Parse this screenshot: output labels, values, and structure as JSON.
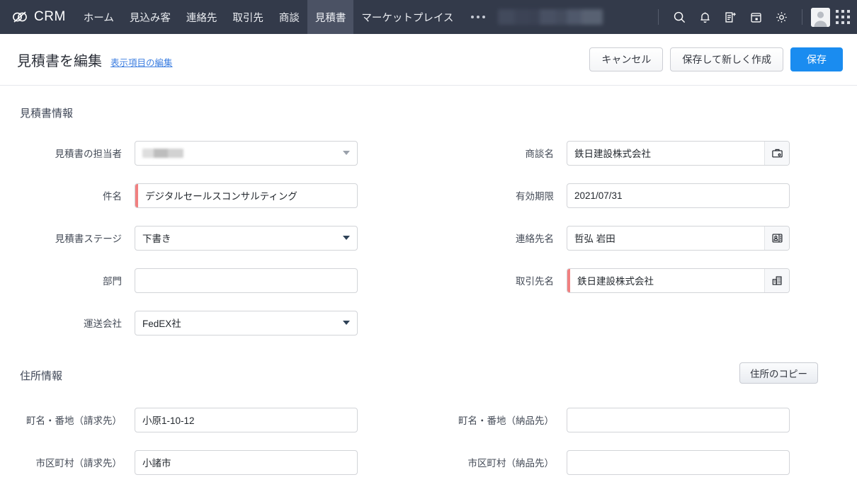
{
  "app": {
    "brand": "CRM",
    "nav_items": [
      {
        "label": "ホーム",
        "active": false
      },
      {
        "label": "見込み客",
        "active": false
      },
      {
        "label": "連絡先",
        "active": false
      },
      {
        "label": "取引先",
        "active": false
      },
      {
        "label": "商談",
        "active": false
      },
      {
        "label": "見積書",
        "active": true
      },
      {
        "label": "マーケットプレイス",
        "active": false
      }
    ],
    "more_label": "...",
    "icons": [
      "search-icon",
      "bell-icon",
      "add-note-icon",
      "calendar-icon",
      "gear-icon",
      "avatar",
      "apps-grid-icon"
    ]
  },
  "header": {
    "title": "見積書を編集",
    "edit_fields_link": "表示項目の編集",
    "cancel_label": "キャンセル",
    "save_new_label": "保存して新しく作成",
    "save_label": "保存",
    "primary_color": "#1a8cf0"
  },
  "sections": {
    "quote_info": {
      "title": "見積書情報",
      "left_fields": [
        {
          "label": "見積書の担当者",
          "value": "",
          "type": "select",
          "required": false,
          "redacted": true,
          "caret": "muted"
        },
        {
          "label": "件名",
          "value": "デジタルセールスコンサルティング",
          "type": "text",
          "required": true
        },
        {
          "label": "見積書ステージ",
          "value": "下書き",
          "type": "select",
          "required": false,
          "caret": "dark"
        },
        {
          "label": "部門",
          "value": "",
          "type": "text",
          "required": false
        },
        {
          "label": "運送会社",
          "value": "FedEX社",
          "type": "select",
          "required": false,
          "caret": "dark"
        }
      ],
      "right_fields": [
        {
          "label": "商談名",
          "value": "鉄日建設株式会社",
          "type": "lookup",
          "required": false,
          "icon": "deal-lookup-icon"
        },
        {
          "label": "有効期限",
          "value": "2021/07/31",
          "type": "text",
          "required": false
        },
        {
          "label": "連絡先名",
          "value": "哲弘 岩田",
          "type": "lookup",
          "required": false,
          "icon": "contact-lookup-icon"
        },
        {
          "label": "取引先名",
          "value": "鉄日建設株式会社",
          "type": "lookup",
          "required": true,
          "icon": "account-lookup-icon"
        }
      ]
    },
    "address_info": {
      "title": "住所情報",
      "copy_address_label": "住所のコピー",
      "left_fields": [
        {
          "label": "町名・番地（請求先）",
          "value": "小原1-10-12",
          "type": "text",
          "required": false
        },
        {
          "label": "市区町村（請求先）",
          "value": "小諸市",
          "type": "text",
          "required": false
        }
      ],
      "right_fields": [
        {
          "label": "町名・番地（納品先）",
          "value": "",
          "type": "text",
          "required": false
        },
        {
          "label": "市区町村（納品先）",
          "value": "",
          "type": "text",
          "required": false
        }
      ]
    }
  },
  "colors": {
    "nav_bg": "#333a4a",
    "nav_active": "#4b5264",
    "required_marker": "#f18080",
    "link": "#3b7de0"
  }
}
